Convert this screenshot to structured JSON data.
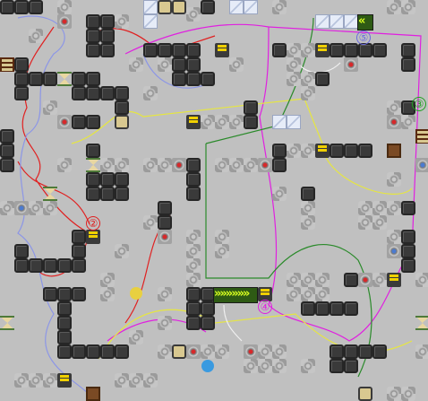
{
  "level": {
    "markers": [
      {
        "label": "②",
        "color": "#e02020"
      },
      {
        "label": "③",
        "color": "#20a020"
      },
      {
        "label": "④",
        "color": "#e020e0"
      },
      {
        "label": "⑤",
        "color": "#6a6ae0"
      }
    ],
    "conveyor_main": {
      "glyphs": "»»»»»»"
    },
    "conveyor_top": {
      "glyphs": "«"
    },
    "balls": [
      {
        "name": "yellow-ball",
        "color": "#e8d040"
      },
      {
        "name": "blue-ball",
        "color": "#3a9ae0"
      }
    ],
    "path_colors": {
      "red": "#e02020",
      "magenta": "#e020e0",
      "blue": "#8c96e6",
      "yellow": "#e6e640",
      "green": "#2a8a2a",
      "white": "#f0f0f0"
    }
  }
}
